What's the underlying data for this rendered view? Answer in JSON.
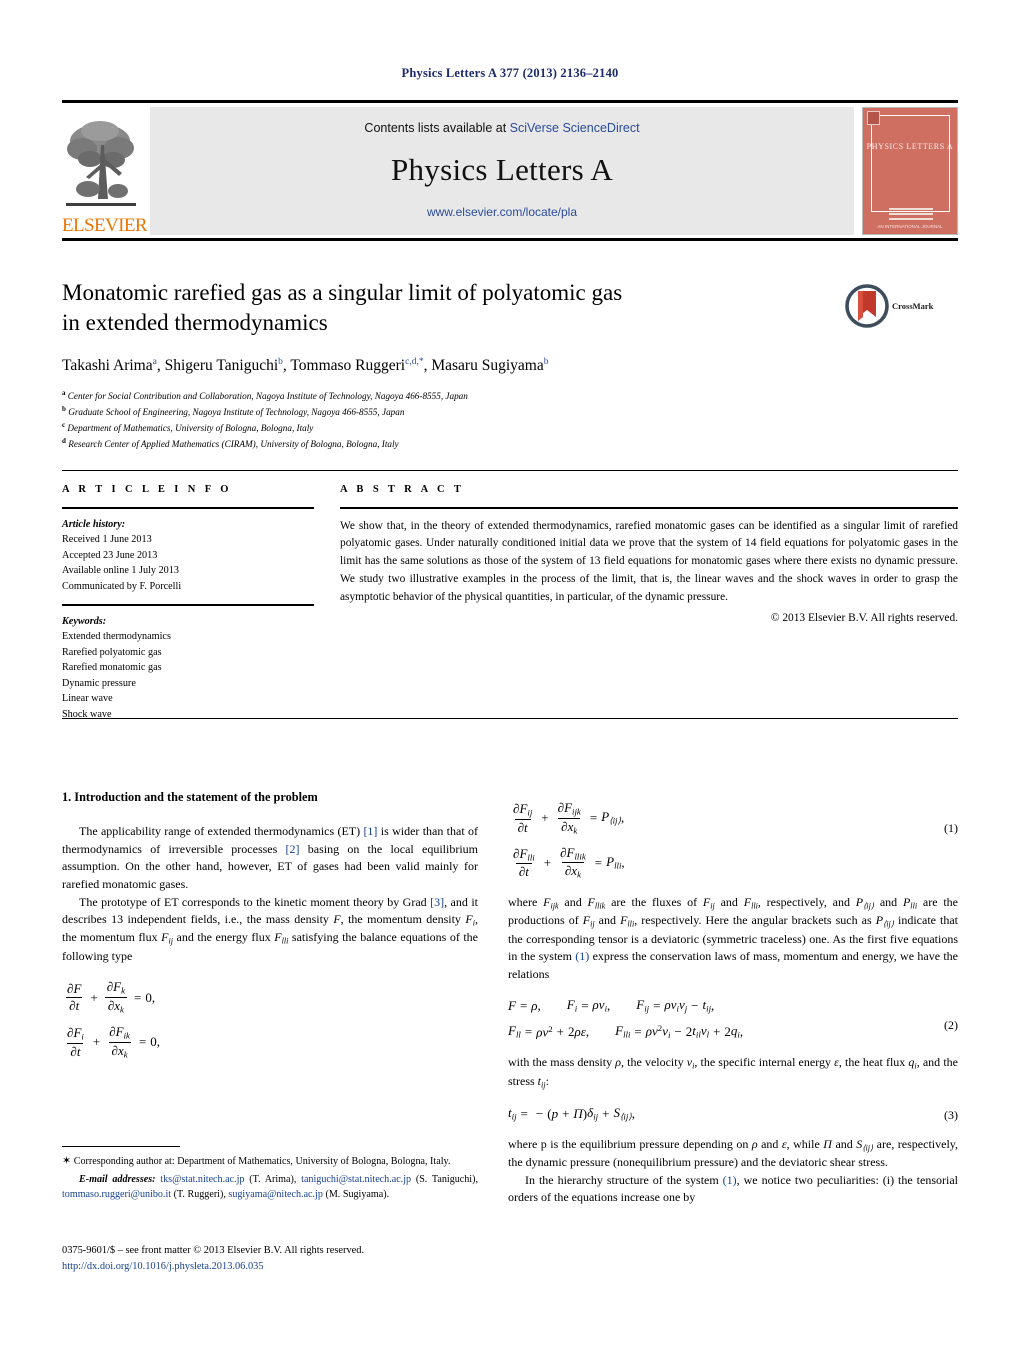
{
  "running_head": "Physics Letters A 377 (2013) 2136–2140",
  "masthead": {
    "contents_prefix": "Contents lists available at ",
    "sciencedirect_link": "SciVerse ScienceDirect",
    "journal_title": "Physics Letters A",
    "journal_url": "www.elsevier.com/locate/pla",
    "publisher_wordmark": "ELSEVIER",
    "cover": {
      "title": "PHYSICS LETTERS A",
      "footer": "AN INTERNATIONAL JOURNAL",
      "color": "#cf6f62"
    }
  },
  "article": {
    "title_line1": "Monatomic rarefied gas as a singular limit of polyatomic gas",
    "title_line2": "in extended thermodynamics",
    "authors": [
      {
        "name": "Takashi Arima",
        "marks": "a"
      },
      {
        "name": "Shigeru Taniguchi",
        "marks": "b"
      },
      {
        "name": "Tommaso Ruggeri",
        "marks": "c,d,*"
      },
      {
        "name": "Masaru Sugiyama",
        "marks": "b"
      }
    ],
    "affiliations": [
      {
        "mark": "a",
        "text": "Center for Social Contribution and Collaboration, Nagoya Institute of Technology, Nagoya 466-8555, Japan"
      },
      {
        "mark": "b",
        "text": "Graduate School of Engineering, Nagoya Institute of Technology, Nagoya 466-8555, Japan"
      },
      {
        "mark": "c",
        "text": "Department of Mathematics, University of Bologna, Bologna, Italy"
      },
      {
        "mark": "d",
        "text": "Research Center of Applied Mathematics (CIRAM), University of Bologna, Bologna, Italy"
      }
    ],
    "crossmark_label": "CrossMark"
  },
  "info": {
    "heading": "A R T I C L E   I N F O",
    "history_label": "Article history:",
    "history": [
      "Received 1 June 2013",
      "Accepted 23 June 2013",
      "Available online 1 July 2013",
      "Communicated by F. Porcelli"
    ],
    "keywords_label": "Keywords:",
    "keywords": [
      "Extended thermodynamics",
      "Rarefied polyatomic gas",
      "Rarefied monatomic gas",
      "Dynamic pressure",
      "Linear wave",
      "Shock wave"
    ]
  },
  "abstract": {
    "heading": "A B S T R A C T",
    "text": "We show that, in the theory of extended thermodynamics, rarefied monatomic gases can be identified as a singular limit of rarefied polyatomic gases. Under naturally conditioned initial data we prove that the system of 14 field equations for polyatomic gases in the limit has the same solutions as those of the system of 13 field equations for monatomic gases where there exists no dynamic pressure. We study two illustrative examples in the process of the limit, that is, the linear waves and the shock waves in order to grasp the asymptotic behavior of the physical quantities, in particular, of the dynamic pressure.",
    "copyright": "© 2013 Elsevier B.V. All rights reserved."
  },
  "body": {
    "section_heading": "1. Introduction and the statement of the problem",
    "left_paragraph_1_a": "The applicability range of extended thermodynamics (ET) ",
    "left_paragraph_1_cite1": "[1]",
    "left_paragraph_1_b": " is wider than that of thermodynamics of irreversible processes ",
    "left_paragraph_1_cite2": "[2]",
    "left_paragraph_1_c": " basing on the local equilibrium assumption. On the other hand, however, ET of gases had been valid mainly for rarefied monatomic gases.",
    "left_paragraph_2_a": "The prototype of ET corresponds to the kinetic moment theory by Grad ",
    "left_paragraph_2_cite": "[3]",
    "left_paragraph_2_b": ", and it describes 13 independent fields, i.e., the mass density ",
    "left_paragraph_2_c": ", the momentum density ",
    "left_paragraph_2_d": ", the momentum flux ",
    "left_paragraph_2_e": " and the energy flux ",
    "left_paragraph_2_f": " satisfying the balance equations of the following type",
    "right_paragraph_1_a": "where ",
    "right_paragraph_1_b": " and ",
    "right_paragraph_1_c": " are the fluxes of ",
    "right_paragraph_1_d": " and ",
    "right_paragraph_1_e": ", respectively, and ",
    "right_paragraph_1_f": " are the productions of ",
    "right_paragraph_1_g": ", respectively. Here the angular brackets such as ",
    "right_paragraph_1_h": " indicate that the corresponding tensor is a deviatoric (symmetric traceless) one. As the first five equations in the system ",
    "right_paragraph_1_cite": "(1)",
    "right_paragraph_1_i": " express the conservation laws of mass, momentum and energy, we have the relations",
    "right_paragraph_2_a": "with the mass density ",
    "right_paragraph_2_b": ", the velocity ",
    "right_paragraph_2_c": ", the specific internal energy ",
    "right_paragraph_2_d": ", the heat flux ",
    "right_paragraph_2_e": ", and the stress ",
    "right_paragraph_2_f": ":",
    "right_paragraph_3_a": "where p is the equilibrium pressure depending on ",
    "right_paragraph_3_b": " and ",
    "right_paragraph_3_c": ", while ",
    "right_paragraph_3_d": " and ",
    "right_paragraph_3_e": " are, respectively, the dynamic pressure (nonequilibrium pressure) and the deviatoric shear stress.",
    "right_paragraph_4_a": "In the hierarchy structure of the system ",
    "right_paragraph_4_cite": "(1)",
    "right_paragraph_4_b": ", we notice two peculiarities: (i) the tensorial orders of the equations increase one by"
  },
  "equations": {
    "eq1_number": "(1)",
    "eq2_number": "(2)",
    "eq3_number": "(3)"
  },
  "footnote": {
    "star": "✶",
    "corresponding": "Corresponding author at: Department of Mathematics, University of Bologna, Bologna, Italy.",
    "email_label": "E-mail addresses:",
    "emails": [
      {
        "addr": "tks@stat.nitech.ac.jp",
        "who": "(T. Arima)"
      },
      {
        "addr": "taniguchi@stat.nitech.ac.jp",
        "who": "(S. Taniguchi)"
      },
      {
        "addr": "tommaso.ruggeri@unibo.it",
        "who": "(T. Ruggeri)"
      },
      {
        "addr": "sugiyama@nitech.ac.jp",
        "who": "(M. Sugiyama)"
      }
    ]
  },
  "frontmatter": {
    "line1": "0375-9601/$ – see front matter © 2013 Elsevier B.V. All rights reserved.",
    "doi": "http://dx.doi.org/10.1016/j.physleta.2013.06.035"
  }
}
